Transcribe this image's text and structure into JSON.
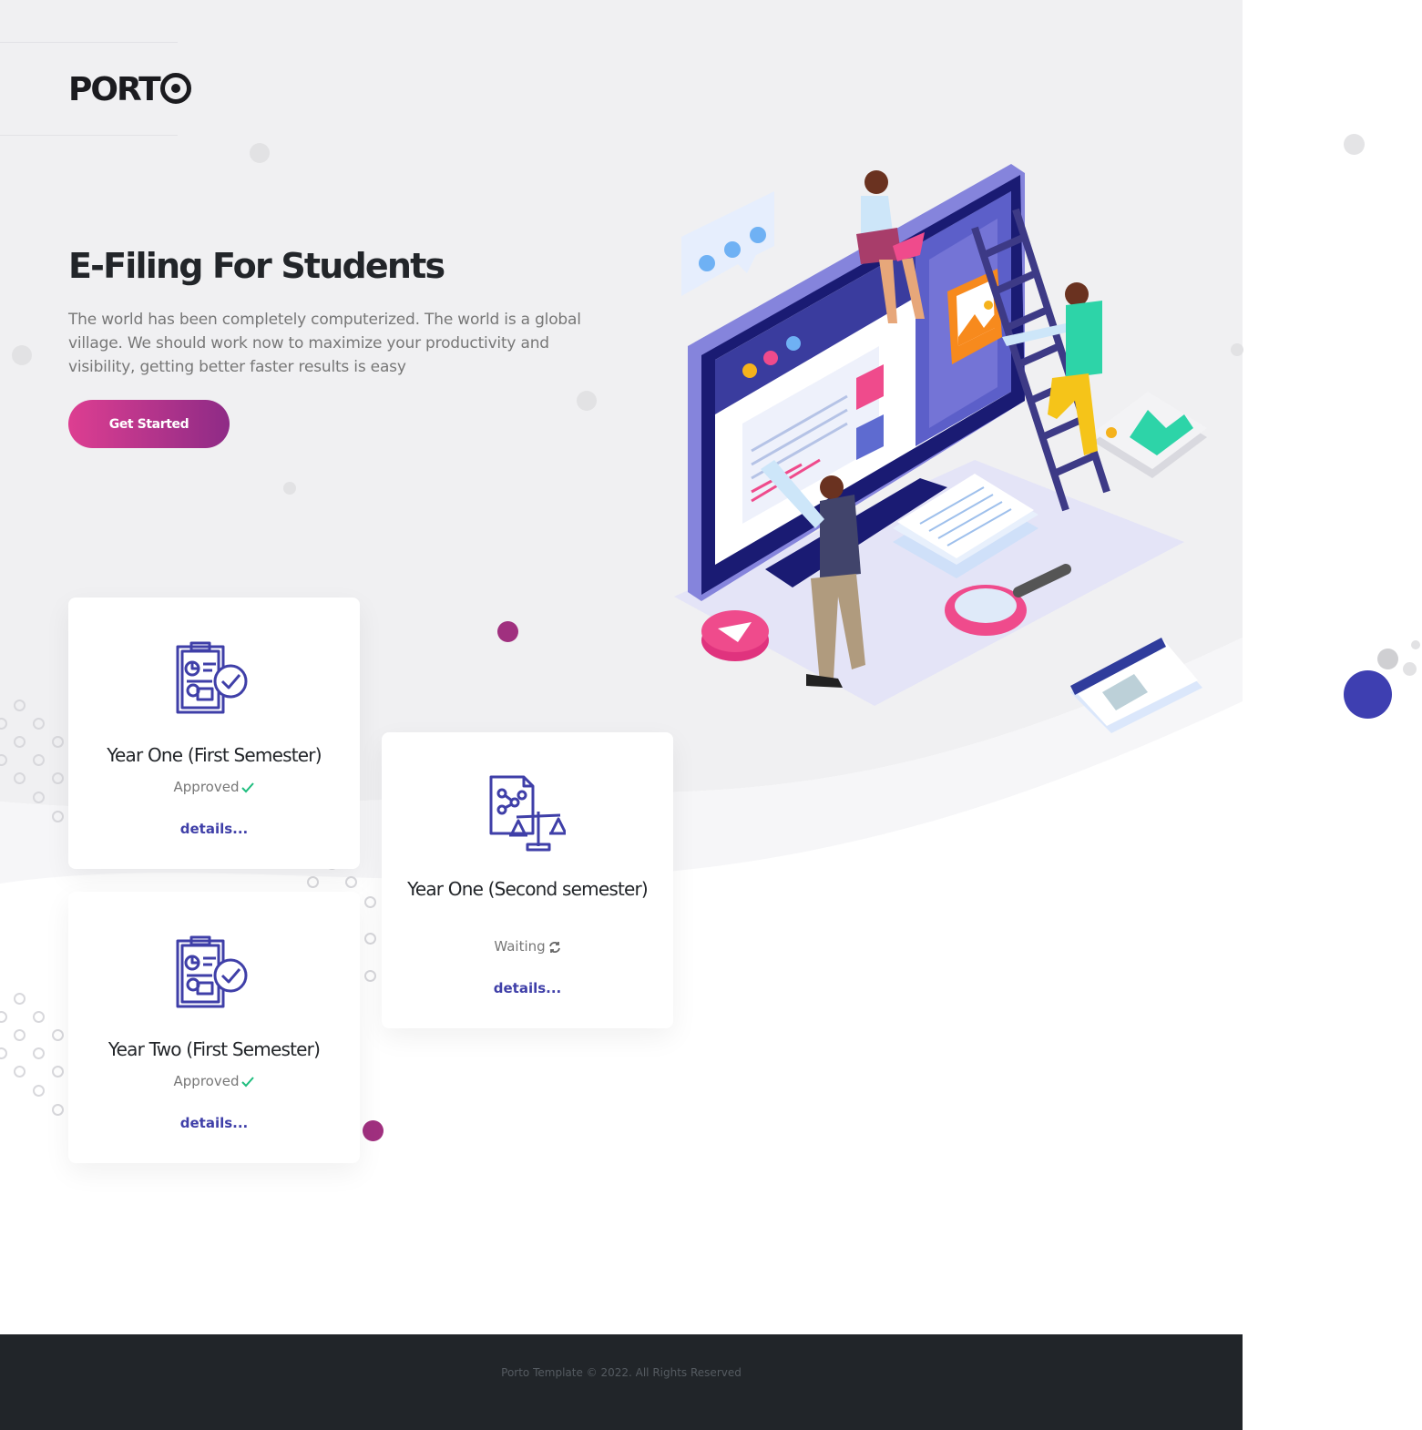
{
  "brand": {
    "logo_text": "PORT"
  },
  "hero": {
    "title": "E-Filing For Students",
    "description": "The world has been completely computerized. The world is a global village. We should work now to maximize your productivity and visibility, getting better faster results is easy",
    "cta_label": "Get Started"
  },
  "cards": [
    {
      "title": "Year One (First Semester)",
      "status": "Approved",
      "status_icon": "check-icon",
      "link": "details..."
    },
    {
      "title": "Year One (Second semester)",
      "status": "Waiting",
      "status_icon": "refresh-icon",
      "link": "details..."
    },
    {
      "title": "Year Two (First Semester)",
      "status": "Approved",
      "status_icon": "check-icon",
      "link": "details..."
    }
  ],
  "footer": {
    "copyright": "Porto Template © 2022. All Rights Reserved"
  },
  "colors": {
    "hero_bg": "#f0f0f2",
    "accent_gradient_start": "#dd3e91",
    "accent_gradient_end": "#8e2b86",
    "link": "#3f3fa8",
    "success": "#1ebd7e",
    "footer_bg": "#212529"
  }
}
